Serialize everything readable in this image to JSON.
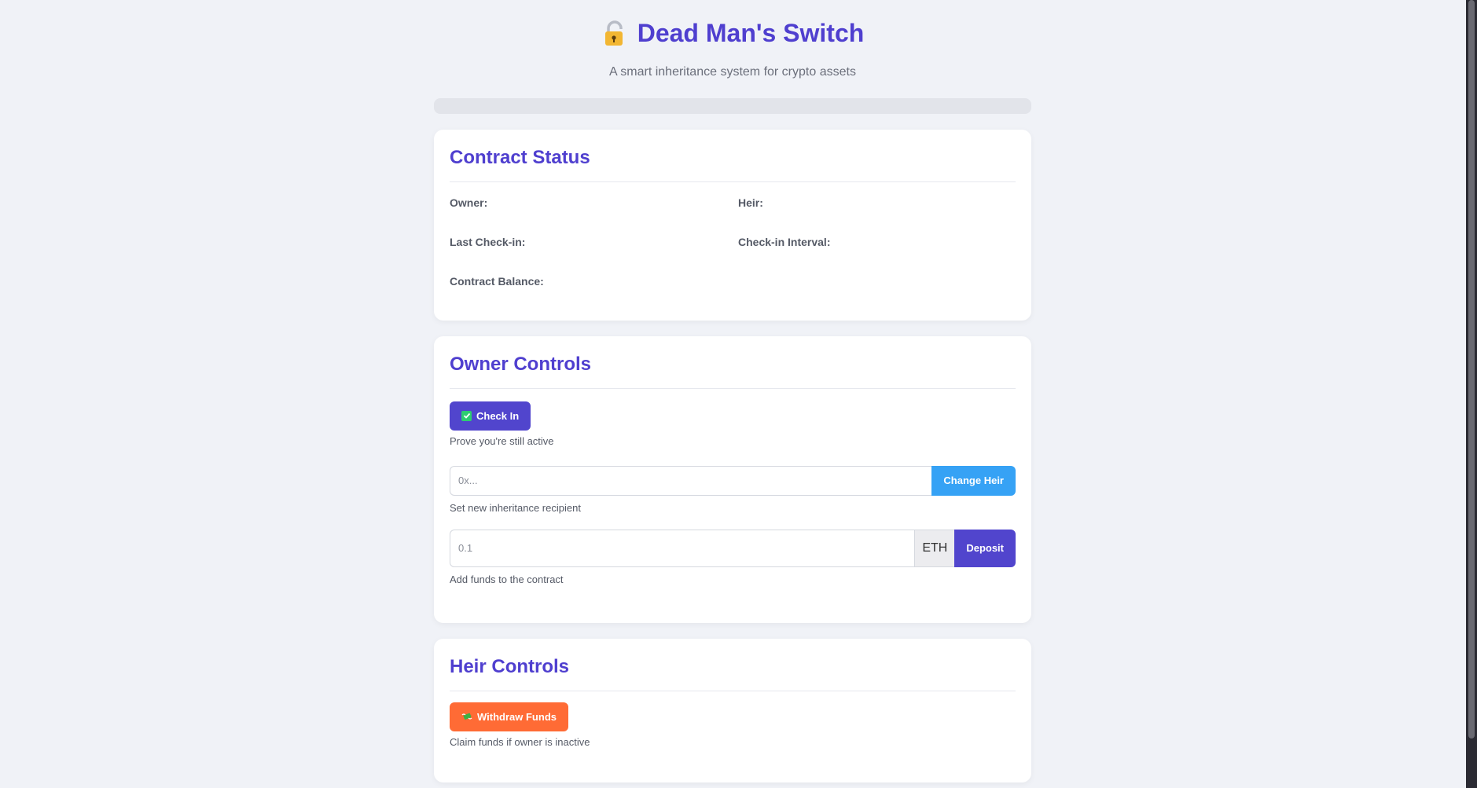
{
  "header": {
    "title": "Dead Man's Switch",
    "subtitle": "A smart inheritance system for crypto assets",
    "icon": "lock-icon"
  },
  "progress": {
    "value_percent": 0
  },
  "contract_status": {
    "heading": "Contract Status",
    "owner_label": "Owner:",
    "owner_value": "",
    "heir_label": "Heir:",
    "heir_value": "",
    "last_checkin_label": "Last Check-in:",
    "last_checkin_value": "",
    "interval_label": "Check-in Interval:",
    "interval_value": "",
    "balance_label": "Contract Balance:",
    "balance_value": ""
  },
  "owner_controls": {
    "heading": "Owner Controls",
    "checkin_button": "Check In",
    "checkin_helper": "Prove you're still active",
    "heir_input_placeholder": "0x...",
    "change_heir_button": "Change Heir",
    "change_heir_helper": "Set new inheritance recipient",
    "deposit_input_placeholder": "0.1",
    "deposit_unit": "ETH",
    "deposit_button": "Deposit",
    "deposit_helper": "Add funds to the contract"
  },
  "heir_controls": {
    "heading": "Heir Controls",
    "withdraw_button": "Withdraw Funds",
    "withdraw_helper": "Claim funds if owner is inactive"
  },
  "colors": {
    "accent": "#5145cd",
    "title": "#4f3fcf",
    "sky": "#36a2f5",
    "orange": "#ff6b35",
    "success": "#2ecc71"
  }
}
